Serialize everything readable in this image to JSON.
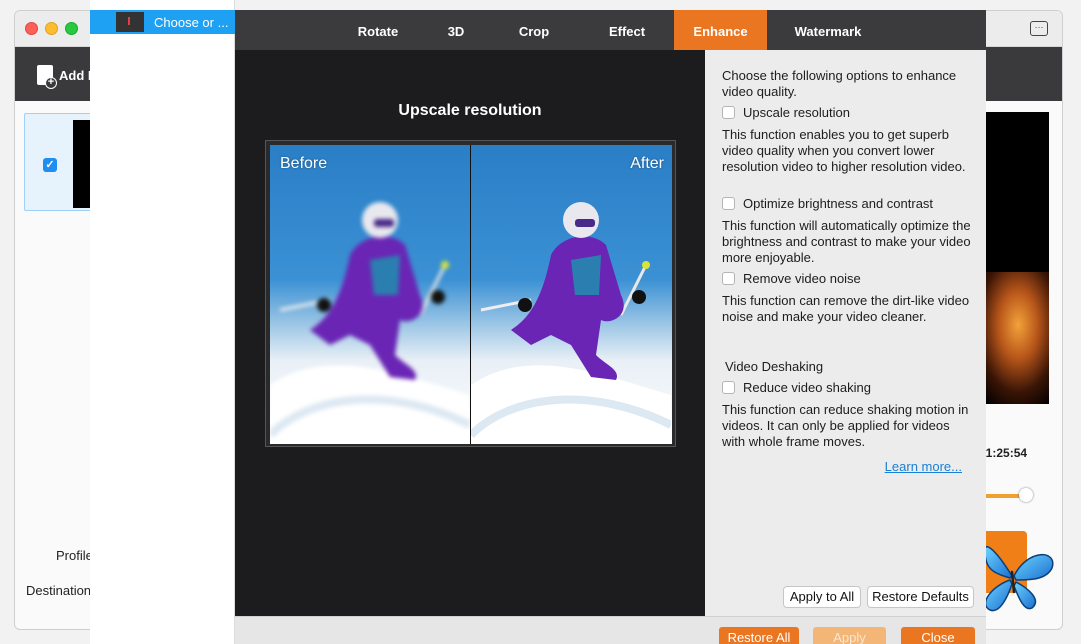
{
  "background_window": {
    "toolbar": {
      "add_file_label": "Add F"
    },
    "labels": {
      "profile": "Profile",
      "destination": "Destination"
    },
    "time": "01:25:54",
    "volume_level": 0.85
  },
  "file_list": {
    "items": [
      {
        "label": "Choose or ...",
        "selected": true
      }
    ]
  },
  "tabs": [
    {
      "label": "Rotate",
      "active": false
    },
    {
      "label": "3D",
      "active": false
    },
    {
      "label": "Crop",
      "active": false
    },
    {
      "label": "Effect",
      "active": false
    },
    {
      "label": "Enhance",
      "active": true
    },
    {
      "label": "Watermark",
      "active": false
    }
  ],
  "preview": {
    "title": "Upscale resolution",
    "before_label": "Before",
    "after_label": "After"
  },
  "options": {
    "intro": "Choose the following options to enhance video quality.",
    "upscale": {
      "label": "Upscale resolution",
      "checked": false,
      "desc": "This function enables you to get superb video quality when you convert lower resolution video to higher resolution video."
    },
    "brightness": {
      "label": "Optimize brightness and contrast",
      "checked": false,
      "desc": "This function will automatically optimize the brightness and contrast to make your video more enjoyable."
    },
    "noise": {
      "label": "Remove video noise",
      "checked": false,
      "desc": "This function can remove the dirt-like video noise and make your video cleaner."
    },
    "deshake_heading": "Video Deshaking",
    "deshake": {
      "label": "Reduce video shaking",
      "checked": false,
      "desc": "This function can reduce shaking motion in videos. It can only be applied for videos with whole frame moves."
    },
    "learn_more": "Learn more..."
  },
  "buttons": {
    "apply_to_all": "Apply to All",
    "restore_defaults": "Restore Defaults",
    "restore_all": "Restore All",
    "apply": "Apply",
    "close": "Close"
  },
  "colors": {
    "accent": "#ea7622",
    "selection": "#1ea1f2",
    "tabbar": "#3b3b3d",
    "preview_bg": "#1c1c1e"
  }
}
